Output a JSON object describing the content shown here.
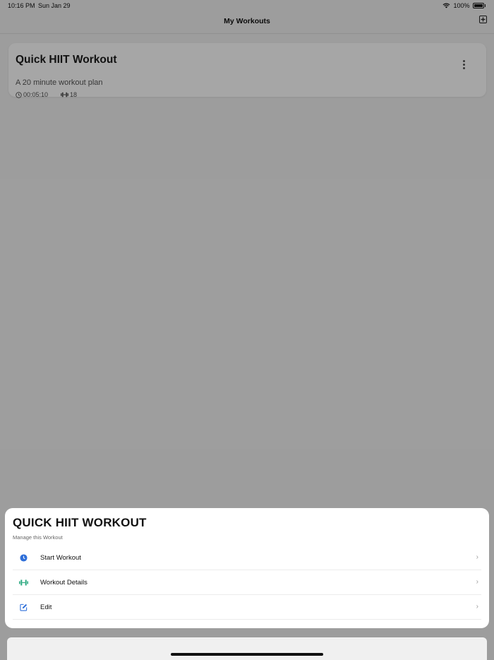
{
  "status_bar": {
    "time": "10:16 PM",
    "date": "Sun Jan 29",
    "battery": "100%"
  },
  "nav": {
    "title": "My Workouts",
    "add_icon": "plus-square-icon"
  },
  "workout": {
    "title": "Quick HIIT Workout",
    "subtitle": "A 20 minute workout plan",
    "duration": "00:05:10",
    "exercise_count": "18"
  },
  "sheet": {
    "title": "QUICK HIIT WORKOUT",
    "subtitle": "Manage this Workout",
    "items": [
      {
        "label": "Start Workout",
        "icon": "clock-icon",
        "color": "#2f6fd9"
      },
      {
        "label": "Workout Details",
        "icon": "dumbbell-icon",
        "color": "#2eaa82"
      },
      {
        "label": "Edit",
        "icon": "edit-icon",
        "color": "#2f6fd9"
      }
    ]
  },
  "colors": {
    "overlay": "#000000",
    "accent_blue": "#2f6fd9",
    "accent_green": "#2eaa82"
  }
}
